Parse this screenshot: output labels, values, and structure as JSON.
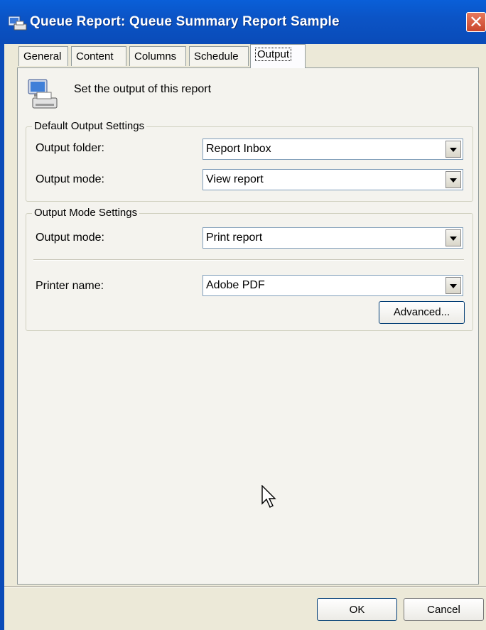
{
  "window": {
    "title": "Queue Report: Queue Summary Report Sample",
    "close_glyph": "✕"
  },
  "tabs": [
    {
      "label": "General"
    },
    {
      "label": "Content"
    },
    {
      "label": "Columns"
    },
    {
      "label": "Schedule"
    },
    {
      "label": "Output",
      "active": true
    }
  ],
  "intro": {
    "text": "Set the output of this report",
    "icon": "printer-computer-icon"
  },
  "default_output": {
    "group_label": "Default Output Settings",
    "folder_label": "Output folder:",
    "folder_value": "Report Inbox",
    "mode_label": "Output mode:",
    "mode_value": "View report"
  },
  "mode_settings": {
    "group_label": "Output Mode Settings",
    "mode_label": "Output mode:",
    "mode_value": "Print report",
    "printer_label": "Printer name:",
    "printer_value": "Adobe PDF",
    "advanced_label": "Advanced..."
  },
  "footer": {
    "ok_label": "OK",
    "cancel_label": "Cancel"
  },
  "colors": {
    "titlebar": "#0a4bb8",
    "face": "#ece9d8"
  }
}
